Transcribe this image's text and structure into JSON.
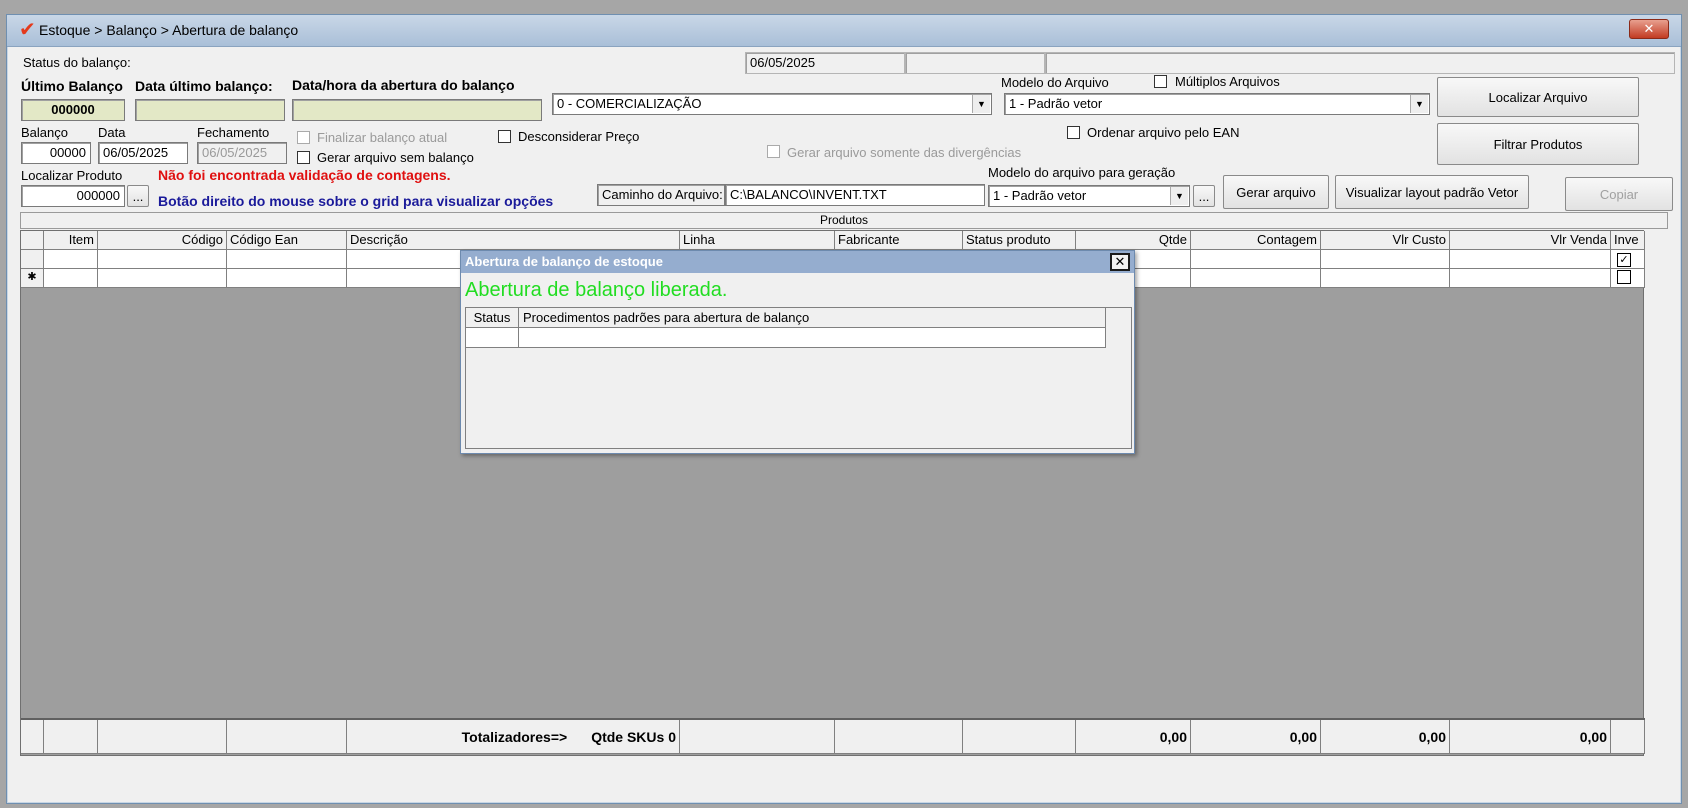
{
  "window": {
    "title": "Estoque > Balanço > Abertura de balanço",
    "close_label": "✕",
    "accent_color": "#e43a1c"
  },
  "status_row": {
    "label": "Status do balanço:",
    "date": "06/05/2025",
    "box2": "",
    "box3": ""
  },
  "header": {
    "ultimo_balanco_label": "Último Balanço",
    "ultimo_balanco_value": "000000",
    "data_ultimo_label": "Data último balanço:",
    "data_ultimo_value": "",
    "abertura_label": "Data/hora da abertura do balanço",
    "abertura_value": "",
    "comercializacao_value": "0 - COMERCIALIZAÇÃO",
    "modelo_arquivo_label": "Modelo do Arquivo",
    "modelo_arquivo_value": "1 - Padrão vetor",
    "multiplos_label": "Múltiplos Arquivos",
    "localizar_arquivo_button": "Localizar Arquivo",
    "filtrar_produtos_button": "Filtrar Produtos"
  },
  "balanco": {
    "balanco_label": "Balanço",
    "balanco_value": "00000",
    "data_label": "Data",
    "data_value": "06/05/2025",
    "fechamento_label": "Fechamento",
    "fechamento_value": "06/05/2025",
    "finalizar_label": "Finalizar balanço atual",
    "gerar_sem_label": "Gerar arquivo sem balanço",
    "desconsiderar_label": "Desconsiderar Preço",
    "gerar_div_label": "Gerar arquivo somente das divergências",
    "ordenar_label": "Ordenar arquivo pelo EAN"
  },
  "localizar": {
    "label": "Localizar Produto",
    "value": "000000",
    "dots": "...",
    "warning": "Não foi encontrada validação de contagens.",
    "hint": "Botão direito do mouse sobre o grid para visualizar opções",
    "caminho_label": "Caminho do Arquivo:",
    "caminho_value": "C:\\BALANCO\\INVENT.TXT",
    "modelo_geracao_label": "Modelo do arquivo para geração",
    "modelo_geracao_value": "1 - Padrão vetor",
    "gerar_arquivo_button": "Gerar arquivo",
    "visualizar_button": "Visualizar layout padrão Vetor",
    "copiar_button": "Copiar"
  },
  "grid": {
    "title": "Produtos",
    "columns": [
      "",
      "Item",
      "Código",
      "Código Ean",
      "Descrição",
      "Linha",
      "Fabricante",
      "Status produto",
      "Qtde",
      "Contagem",
      "Vlr Custo",
      "Vlr Venda",
      "Inve"
    ],
    "row_marker": "✱",
    "totals": {
      "label": "Totalizadores=>",
      "skus": "Qtde SKUs 0",
      "qtde": "0,00",
      "contagem": "0,00",
      "custo": "0,00",
      "venda": "0,00"
    }
  },
  "dialog": {
    "title": "Abertura de balanço de estoque",
    "close_label": "✕",
    "message": "Abertura de balanço liberada.",
    "message_color": "#22dd22",
    "col_status": "Status",
    "col_procedimentos": "Procedimentos padrões para abertura de balanço"
  }
}
